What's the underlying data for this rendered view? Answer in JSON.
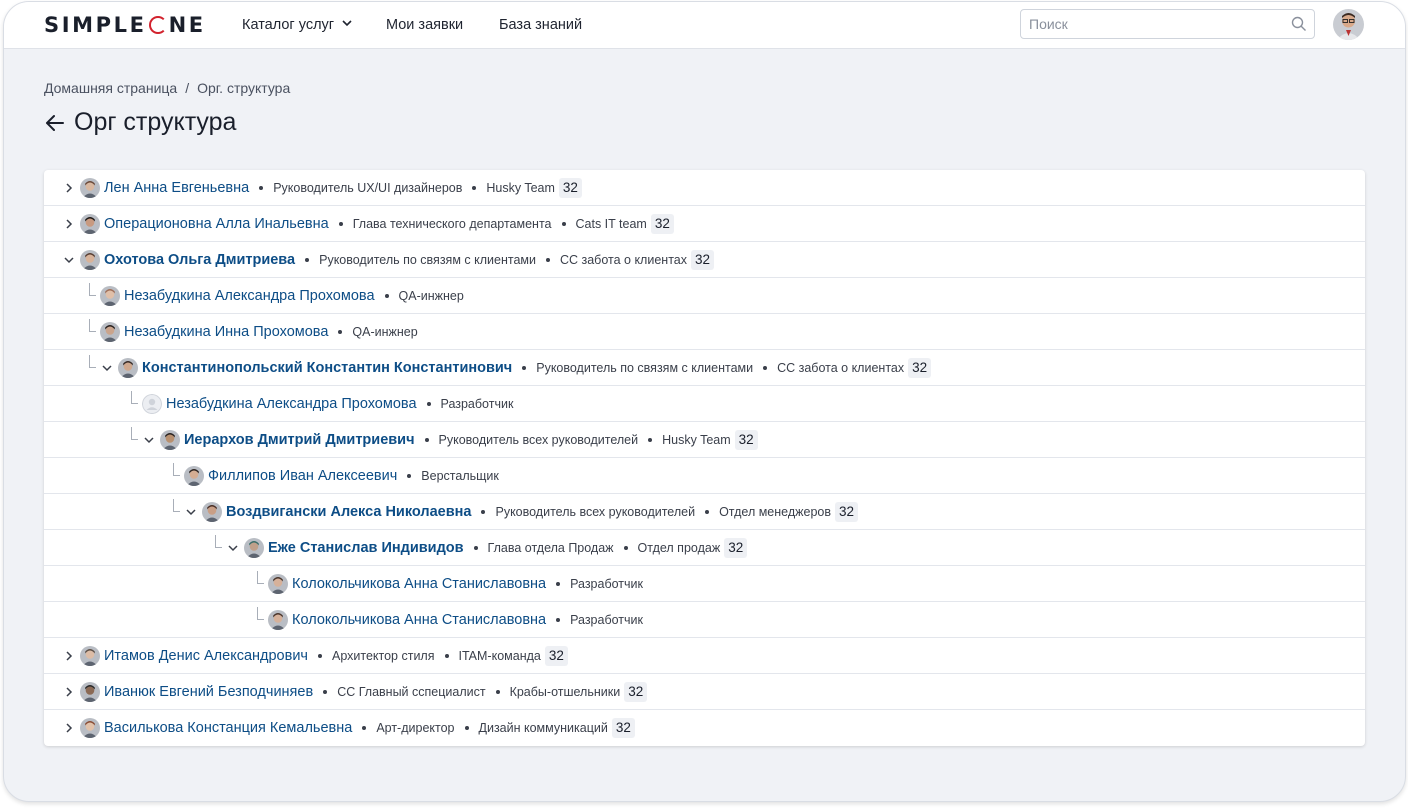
{
  "header": {
    "logo": "SIMPLEONE",
    "nav": [
      {
        "label": "Каталог услуг"
      },
      {
        "label": "Мои заявки"
      },
      {
        "label": "База знаний"
      }
    ],
    "search_placeholder": "Поиск"
  },
  "breadcrumb": {
    "home": "Домашняя страница",
    "separator": "/",
    "current": "Орг. структура"
  },
  "page_title": "Орг структура",
  "colors": {
    "accent": "#0d4d86",
    "brand_red": "#d2222d"
  },
  "tree": [
    {
      "name": "Лен Анна Евгеньевна",
      "role": "Руководитель UX/UI дизайнеров",
      "team": "Husky Team",
      "count": "32",
      "level": 0,
      "state": "collapsed"
    },
    {
      "name": "Операционовна Алла Инальевна",
      "role": "Глава технического департамента",
      "team": "Cats IT team",
      "count": "32",
      "level": 0,
      "state": "collapsed"
    },
    {
      "name": "Охотова Ольга Дмитриева",
      "role": "Руководитель по связям с клиентами",
      "team": "СС забота о клиентах",
      "count": "32",
      "level": 0,
      "state": "expanded"
    },
    {
      "name": "Незабудкина Александра Прохомова",
      "role": "QA-инжнер",
      "level": 1,
      "state": "leaf"
    },
    {
      "name": "Незабудкина Инна Прохомова",
      "role": "QA-инжнер",
      "level": 1,
      "state": "leaf"
    },
    {
      "name": "Константинопольский Константин Константинович",
      "role": "Руководитель по связям с клиентами",
      "team": "СС забота о клиентах",
      "count": "32",
      "level": 1,
      "state": "expanded"
    },
    {
      "name": "Незабудкина Александра Прохомова",
      "role": "Разработчик",
      "level": 2,
      "state": "leaf",
      "placeholder_avatar": true
    },
    {
      "name": "Иерархов Дмитрий Дмитриевич",
      "role": "Руководитель всех руководителей",
      "team": "Husky Team",
      "count": "32",
      "level": 2,
      "state": "expanded"
    },
    {
      "name": "Филлипов Иван Алексеевич",
      "role": "Верстальщик",
      "level": 3,
      "state": "leaf"
    },
    {
      "name": "Воздвигански Алекса Николаевна",
      "role": "Руководитель всех руководителей",
      "team": "Отдел менеджеров",
      "count": "32",
      "level": 3,
      "state": "expanded"
    },
    {
      "name": "Еже Станислав Индивидов",
      "role": "Глава отдела Продаж",
      "team": "Отдел продаж",
      "count": "32",
      "level": 4,
      "state": "expanded"
    },
    {
      "name": "Колокольчикова Анна Станиславовна",
      "role": "Разработчик",
      "level": 5,
      "state": "leaf"
    },
    {
      "name": "Колокольчикова Анна Станиславовна",
      "role": "Разработчик",
      "level": 5,
      "state": "leaf"
    },
    {
      "name": "Итамов Денис Александрович",
      "role": "Архитектор стиля",
      "team": "ITAM-команда",
      "count": "32",
      "level": 0,
      "state": "collapsed"
    },
    {
      "name": "Иванюк  Евгений Безподчиняев",
      "role": "СС Главный сспециалист",
      "team": "Крабы-отшельники",
      "count": "32",
      "level": 0,
      "state": "collapsed"
    },
    {
      "name": "Василькова Констанция Кемальевна",
      "role": "Арт-директор",
      "team": "Дизайн коммуникаций",
      "count": "32",
      "level": 0,
      "state": "collapsed"
    }
  ]
}
